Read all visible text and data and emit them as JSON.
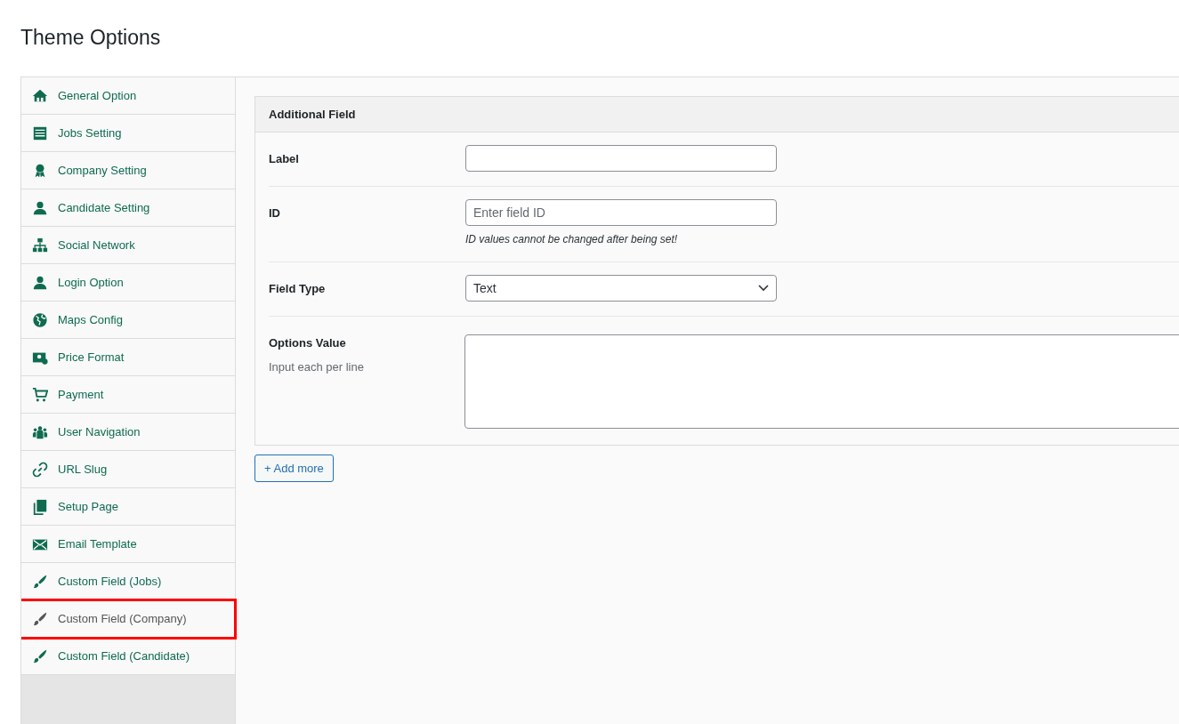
{
  "page_title": "Theme Options",
  "sidebar": {
    "items": [
      {
        "label": "General Option",
        "selected": false
      },
      {
        "label": "Jobs Setting",
        "selected": false
      },
      {
        "label": "Company Setting",
        "selected": false
      },
      {
        "label": "Candidate Setting",
        "selected": false
      },
      {
        "label": "Social Network",
        "selected": false
      },
      {
        "label": "Login Option",
        "selected": false
      },
      {
        "label": "Maps Config",
        "selected": false
      },
      {
        "label": "Price Format",
        "selected": false
      },
      {
        "label": "Payment",
        "selected": false
      },
      {
        "label": "User Navigation",
        "selected": false
      },
      {
        "label": "URL Slug",
        "selected": false
      },
      {
        "label": "Setup Page",
        "selected": false
      },
      {
        "label": "Email Template",
        "selected": false
      },
      {
        "label": "Custom Field (Jobs)",
        "selected": false
      },
      {
        "label": "Custom Field (Company)",
        "selected": true
      },
      {
        "label": "Custom Field (Candidate)",
        "selected": false
      }
    ]
  },
  "panel": {
    "title": "Additional Field",
    "rows": [
      {
        "kind": "input",
        "label": "Label"
      },
      {
        "kind": "input",
        "label": "ID",
        "placeholder": "Enter field ID",
        "note": "ID values cannot be changed after being set!"
      },
      {
        "kind": "select",
        "label": "Field Type",
        "value": "Text"
      },
      {
        "kind": "textarea",
        "label": "Options Value",
        "hint": "Input each per line"
      }
    ]
  },
  "add_button": "+ Add more"
}
